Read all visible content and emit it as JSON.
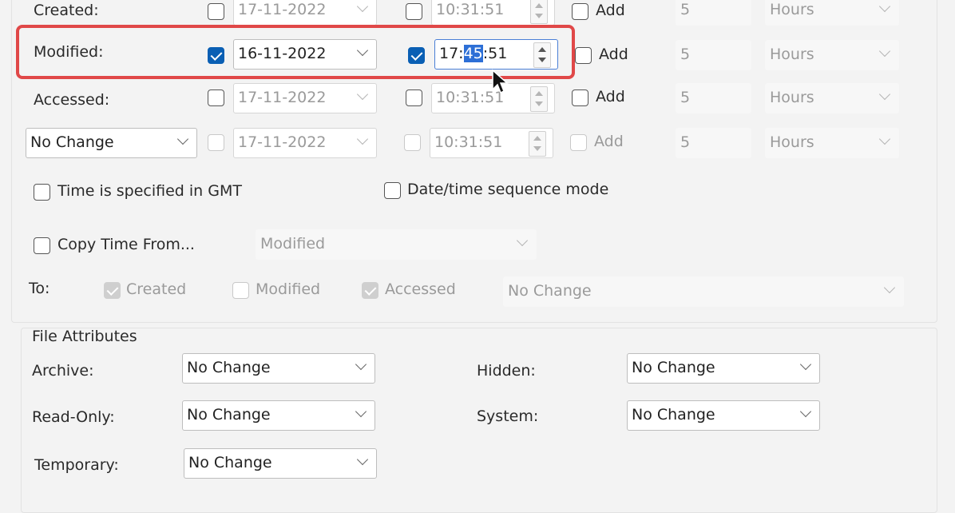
{
  "timestamps": {
    "rows": [
      {
        "label": "Created:",
        "date_checked": false,
        "date": "17-11-2022",
        "time_checked": false,
        "time": "10:31:51",
        "add_label": "Add",
        "amount": "5",
        "unit": "Hours",
        "disabled": true
      },
      {
        "label": "Modified:",
        "date_checked": true,
        "date": "16-11-2022",
        "time_checked": true,
        "time_before": "17:",
        "time_selected": "45",
        "time_after": ":51",
        "add_label": "Add",
        "amount": "5",
        "unit": "Hours",
        "disabled": false
      },
      {
        "label": "Accessed:",
        "date_checked": false,
        "date": "17-11-2022",
        "time_checked": false,
        "time": "10:31:51",
        "add_label": "Add",
        "amount": "5",
        "unit": "Hours",
        "disabled": true
      },
      {
        "selector": "No Change",
        "date": "17-11-2022",
        "time": "10:31:51",
        "add_label": "Add",
        "amount": "5",
        "unit": "Hours",
        "disabled": true
      }
    ],
    "gmt_label": "Time is specified in GMT",
    "sequence_label": "Date/time sequence mode",
    "copy_time_label": "Copy Time From...",
    "copy_source": "Modified",
    "to_label": "To:",
    "to_created": "Created",
    "to_modified": "Modified",
    "to_accessed": "Accessed",
    "to_select": "No Change"
  },
  "file_attributes": {
    "title": "File Attributes",
    "archive_label": "Archive:",
    "archive_value": "No Change",
    "readonly_label": "Read-Only:",
    "readonly_value": "No Change",
    "temporary_label": "Temporary:",
    "temporary_value": "No Change",
    "hidden_label": "Hidden:",
    "hidden_value": "No Change",
    "system_label": "System:",
    "system_value": "No Change"
  },
  "colors": {
    "highlight": "#e04848",
    "checkbox_on": "#0a5fb4",
    "selection": "#2d6fd6"
  }
}
